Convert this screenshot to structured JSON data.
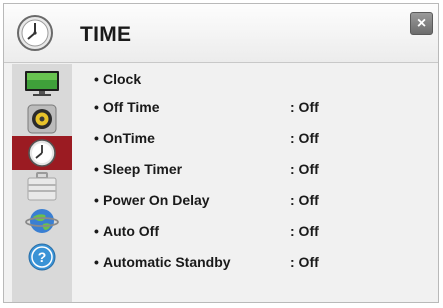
{
  "window": {
    "title": "TIME",
    "close_label": "×"
  },
  "sidebar": {
    "items": [
      {
        "name": "picture",
        "icon": "tv-icon"
      },
      {
        "name": "audio",
        "icon": "speaker-icon"
      },
      {
        "name": "time",
        "icon": "clock-icon",
        "active": true
      },
      {
        "name": "lock",
        "icon": "briefcase-icon"
      },
      {
        "name": "network",
        "icon": "globe-icon"
      },
      {
        "name": "support",
        "icon": "help-icon"
      }
    ]
  },
  "menu": {
    "items": [
      {
        "label": "Clock",
        "value": ""
      },
      {
        "label": "Off Time",
        "value": ": Off"
      },
      {
        "label": "OnTime",
        "value": ": Off"
      },
      {
        "label": "Sleep Timer",
        "value": ": Off"
      },
      {
        "label": "Power On Delay",
        "value": ": Off"
      },
      {
        "label": "Auto Off",
        "value": ": Off"
      },
      {
        "label": "Automatic Standby",
        "value": ": Off"
      }
    ]
  },
  "colors": {
    "active_sidebar": "#9b1b22",
    "background": "#f1f1f1"
  }
}
